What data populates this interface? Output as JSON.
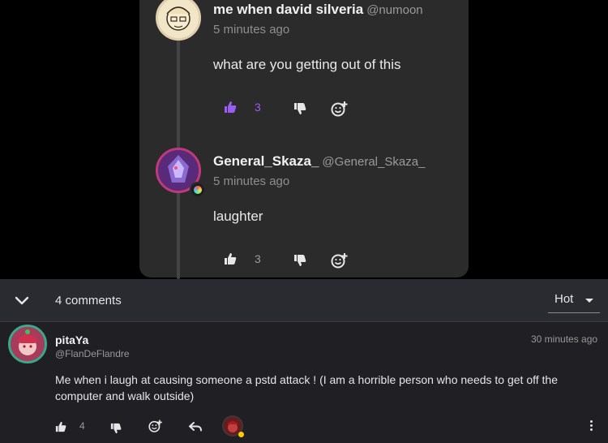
{
  "thread": {
    "reply1": {
      "username": "me when david silveria",
      "handle": "@numoon",
      "time": "5 minutes ago",
      "text": "what are you getting out of this",
      "likes": "3",
      "liked_color": "#9b5cf6"
    },
    "reply2": {
      "username": "General_Skaza_",
      "handle": "@General_Skaza_",
      "time": "5 minutes ago",
      "text": "laughter",
      "likes": "3"
    }
  },
  "comments_bar": {
    "count_label": "4 comments",
    "sort_label": "Hot"
  },
  "comment": {
    "username": "pitaYa",
    "handle": "@FlanDeFlandre",
    "time": "30 minutes ago",
    "text": "Me when i laugh at causing someone a pstd attack ! (I am a horrible person who needs to get off the computer and walk outside)",
    "likes": "4"
  },
  "icons": [
    "like-icon",
    "dislike-icon",
    "add-reaction-icon",
    "reply-icon",
    "more-icon",
    "chevron-down-icon"
  ]
}
